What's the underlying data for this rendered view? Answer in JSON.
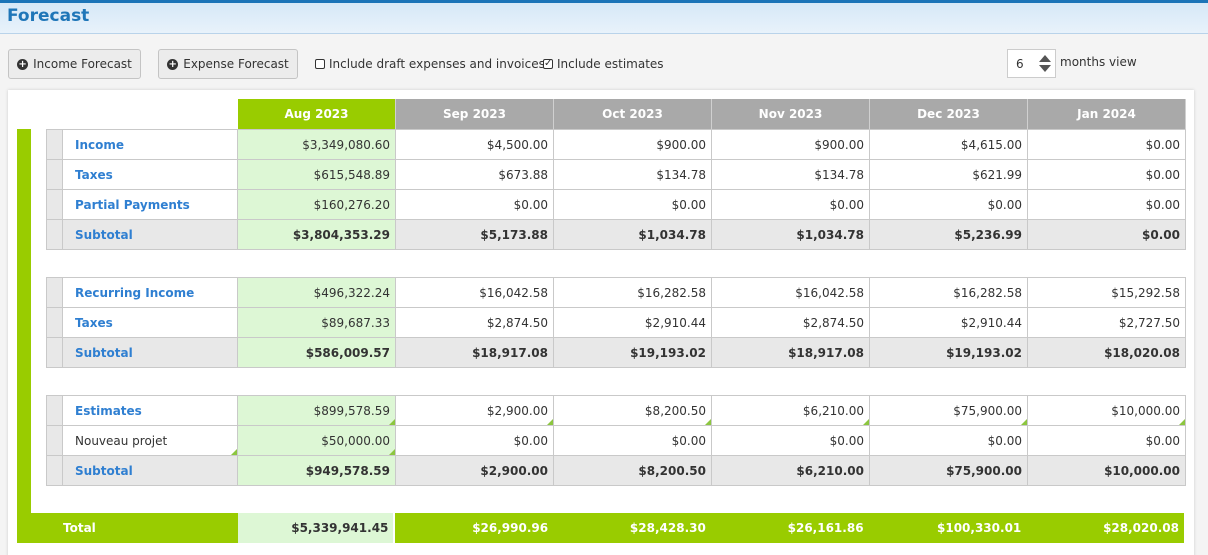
{
  "page": {
    "title": "Forecast"
  },
  "toolbar": {
    "income_forecast_label": "Income Forecast",
    "expense_forecast_label": "Expense Forecast",
    "include_drafts_label": "Include draft expenses and invoices",
    "include_drafts_checked": false,
    "include_estimates_label": "Include estimates",
    "include_estimates_checked": true,
    "months_value": "6",
    "months_label": "months view"
  },
  "colors": {
    "accent_green": "#99cc00",
    "current_month_bg": "#ddf7d5",
    "header_grey": "#a9a9a9",
    "title_blue": "#1f76b8",
    "link_blue": "#2f7fd1"
  },
  "columns": [
    "Aug 2023",
    "Sep 2023",
    "Oct 2023",
    "Nov 2023",
    "Dec 2023",
    "Jan 2024"
  ],
  "sections": [
    {
      "rows": [
        {
          "label": "Income",
          "values": [
            "$3,349,080.60",
            "$4,500.00",
            "$900.00",
            "$900.00",
            "$4,615.00",
            "$0.00"
          ]
        },
        {
          "label": "Taxes",
          "values": [
            "$615,548.89",
            "$673.88",
            "$134.78",
            "$134.78",
            "$621.99",
            "$0.00"
          ]
        },
        {
          "label": "Partial Payments",
          "values": [
            "$160,276.20",
            "$0.00",
            "$0.00",
            "$0.00",
            "$0.00",
            "$0.00"
          ]
        }
      ],
      "subtotal": {
        "label": "Subtotal",
        "values": [
          "$3,804,353.29",
          "$5,173.88",
          "$1,034.78",
          "$1,034.78",
          "$5,236.99",
          "$0.00"
        ]
      }
    },
    {
      "rows": [
        {
          "label": "Recurring Income",
          "values": [
            "$496,322.24",
            "$16,042.58",
            "$16,282.58",
            "$16,042.58",
            "$16,282.58",
            "$15,292.58"
          ]
        },
        {
          "label": "Taxes",
          "values": [
            "$89,687.33",
            "$2,874.50",
            "$2,910.44",
            "$2,874.50",
            "$2,910.44",
            "$2,727.50"
          ]
        }
      ],
      "subtotal": {
        "label": "Subtotal",
        "values": [
          "$586,009.57",
          "$18,917.08",
          "$19,193.02",
          "$18,917.08",
          "$19,193.02",
          "$18,020.08"
        ]
      }
    },
    {
      "rows": [
        {
          "label": "Estimates",
          "values": [
            "$899,578.59",
            "$2,900.00",
            "$8,200.50",
            "$6,210.00",
            "$75,900.00",
            "$10,000.00"
          ]
        },
        {
          "label": "Nouveau projet",
          "values": [
            "$50,000.00",
            "$0.00",
            "$0.00",
            "$0.00",
            "$0.00",
            "$0.00"
          ]
        }
      ],
      "subtotal": {
        "label": "Subtotal",
        "values": [
          "$949,578.59",
          "$2,900.00",
          "$8,200.50",
          "$6,210.00",
          "$75,900.00",
          "$10,000.00"
        ]
      }
    }
  ],
  "total": {
    "label": "Total",
    "values": [
      "$5,339,941.45",
      "$26,990.96",
      "$28,428.30",
      "$26,161.86",
      "$100,330.01",
      "$28,020.08"
    ]
  }
}
